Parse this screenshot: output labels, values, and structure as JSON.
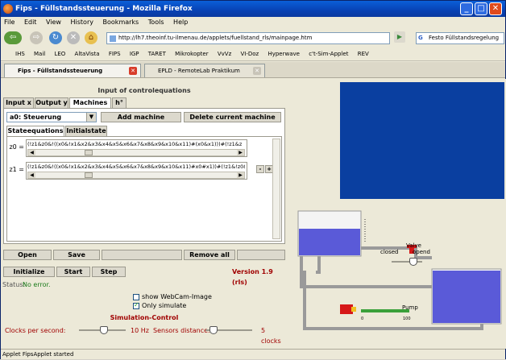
{
  "window": {
    "title": "Fips - Füllstandssteuerung - Mozilla Firefox",
    "min": "_",
    "max": "□",
    "close": "✕"
  },
  "menu": [
    "File",
    "Edit",
    "View",
    "History",
    "Bookmarks",
    "Tools",
    "Help"
  ],
  "nav": {
    "back": "⇦",
    "forward": "⇨",
    "reload": "↻",
    "stop": "✕",
    "home": "⌂",
    "url": "http://lh7.theoinf.tu-ilmenau.de/applets/fuellstand_rls/mainpage.htm",
    "search_engine": "G",
    "search": "Festo Füllstandsregelung"
  },
  "bookmarks": [
    "IHS",
    "Mail",
    "LEO",
    "AltaVista",
    "FIPS",
    "IGP",
    "TARET",
    "Mikrokopter",
    "VvVz",
    "VI-Doz",
    "Hyperwave",
    "c't-Sim-Applet",
    "REV"
  ],
  "tabs": [
    {
      "label": "Fips - Füllstandssteuerung",
      "active": true
    },
    {
      "label": "EPLD - RemoteLab Praktikum",
      "active": false
    }
  ],
  "applet": {
    "header": "Input of controlequations",
    "tabs": [
      "Input x",
      "Output y",
      "Machines a",
      "h°"
    ],
    "machine_select": "a0: Steuerung",
    "add_machine": "Add machine",
    "delete_machine": "Delete current machine",
    "subtabs": [
      "Stateequations z",
      "Initialstate"
    ],
    "equations": [
      {
        "label": "z0 =",
        "text": "(!z1&z0&!((x0&!x1&x2&x3&x4&x5&x6&x7&x8&x9&x10&x11)#(x0&x1)))#(!z1&z"
      },
      {
        "label": "z1 =",
        "text": "(!z1&z0&!((x0&!x1&x2&x3&x4&x5&x6&x7&x8&x9&x10&x11)#x0#x1))#(!z1&!z0&"
      }
    ],
    "eq_minus": "-",
    "eq_plus": "+",
    "open": "Open",
    "save": "Save",
    "remove_all": "Remove all",
    "initialize": "Initialize",
    "start": "Start",
    "step": "Step",
    "version": "Version 1.9 (rls)",
    "status_label": "Status:",
    "status_value": "No error.",
    "webcam": "show WebCam-Image",
    "only_simulate": "Only simulate",
    "sim_header": "Simulation-Control",
    "clocks_label": "Clocks per second:",
    "clocks_value": "10 Hz",
    "sensors_label": "Sensors distance:",
    "sensors_value": "5 clocks",
    "clocks_level": 0.55,
    "sensors_level": 0.1
  },
  "plant": {
    "valve_title": "Valve",
    "valve_closed": "closed",
    "valve_opend": "opend",
    "valve_level": 0.8,
    "pump_title": "Pump",
    "pump_scale_min": "0",
    "pump_scale_max": "100",
    "colors": {
      "video": "#0a3fa0",
      "water": "#5a5ad8",
      "pipe": "#9a9a9a",
      "pump": "#d61818"
    }
  },
  "statusbar": "Applet FipsApplet started"
}
